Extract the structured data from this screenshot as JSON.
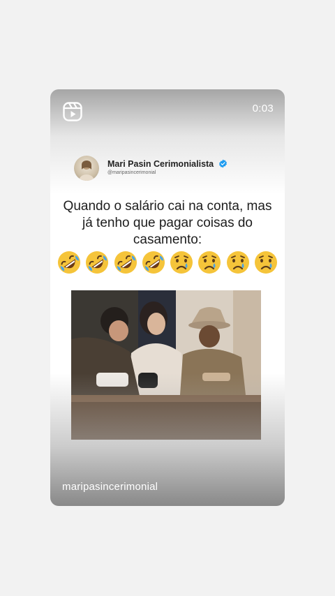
{
  "reel": {
    "timer": "0:03",
    "author": "maripasincerimonial"
  },
  "tweet": {
    "display_name": "Mari Pasin Cerimonialista",
    "handle": "@maripasincerimonial",
    "verified": true,
    "text": "Quando o salário cai na conta, mas já tenho que pagar coisas do casamento:",
    "emojis": [
      "rolling-on-floor-laughing",
      "rolling-on-floor-laughing",
      "rolling-on-floor-laughing",
      "rolling-on-floor-laughing",
      "crying-face",
      "crying-face",
      "crying-face",
      "crying-face"
    ]
  },
  "icons": {
    "reels": "reels-icon",
    "verified": "verified-badge-icon"
  },
  "colors": {
    "background": "#f2f2f2",
    "verified": "#1d9bf0",
    "emoji_yellow": "#f5c43a"
  }
}
